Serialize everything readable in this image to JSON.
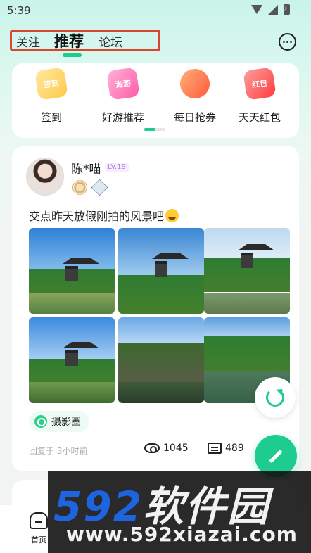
{
  "status_bar": {
    "time": "5:39"
  },
  "header": {
    "tabs": [
      {
        "label": "关注"
      },
      {
        "label": "推荐"
      },
      {
        "label": "论坛"
      }
    ]
  },
  "quick_features": [
    {
      "label": "签到",
      "icon_text": "签到",
      "icon": "checkin-icon"
    },
    {
      "label": "好游推荐",
      "icon_text": "淘游",
      "icon": "game-recommend-icon"
    },
    {
      "label": "每日抢券",
      "icon_text": "",
      "icon": "coupon-icon"
    },
    {
      "label": "天天红包",
      "icon_text": "红包",
      "icon": "red-packet-icon"
    }
  ],
  "post": {
    "username": "陈*喵",
    "level": "LV.19",
    "text": "交点昨天放假刚拍的风景吧",
    "photos": [
      {
        "icon": "landscape-photo"
      },
      {
        "icon": "landscape-photo"
      },
      {
        "icon": "landscape-photo"
      },
      {
        "icon": "landscape-photo"
      },
      {
        "icon": "landscape-photo"
      },
      {
        "icon": "landscape-photo"
      }
    ],
    "tag": "摄影圈",
    "reply_time": "回复于 3小时前",
    "views": "1045",
    "comments": "489"
  },
  "bottom_nav": {
    "home_label": "首页"
  },
  "watermark": {
    "number": "592",
    "name": "软件园",
    "url": "www.592xiazai.com"
  },
  "colors": {
    "accent": "#1dcc8e",
    "highlight_box": "#d9462d"
  }
}
